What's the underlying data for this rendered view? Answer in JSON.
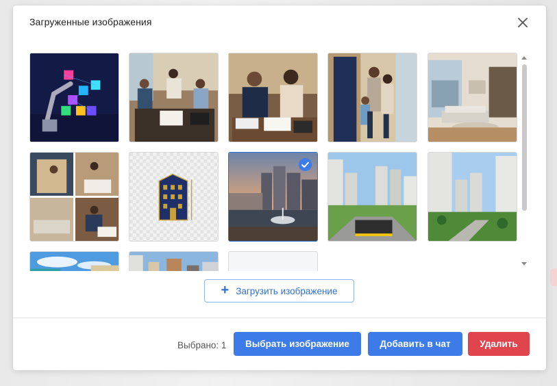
{
  "modal": {
    "title": "Загруженные изображения",
    "upload_label": "Загрузить изображение",
    "selected_label": "Выбрано: 1",
    "buttons": {
      "select": "Выбрать изображение",
      "add_to_chat": "Добавить в чат",
      "delete": "Удалить"
    }
  },
  "images": [
    {
      "name": "image-tile-tech-cubes",
      "selected": false
    },
    {
      "name": "image-tile-office-meeting",
      "selected": false
    },
    {
      "name": "image-tile-couple-signing",
      "selected": false
    },
    {
      "name": "image-tile-family-door",
      "selected": false
    },
    {
      "name": "image-tile-living-room",
      "selected": false
    },
    {
      "name": "image-tile-collage",
      "selected": false
    },
    {
      "name": "image-tile-building-logo",
      "selected": false
    },
    {
      "name": "image-tile-waterfront",
      "selected": true
    },
    {
      "name": "image-tile-residential-complex",
      "selected": false
    },
    {
      "name": "image-tile-park-towers",
      "selected": false
    },
    {
      "name": "image-tile-sky-buildings",
      "selected": false
    },
    {
      "name": "image-tile-city-towers",
      "selected": false
    },
    {
      "name": "image-tile-placeholder",
      "selected": false
    }
  ],
  "colors": {
    "primary": "#3d7ce8",
    "danger": "#e0444d",
    "selected_border": "#2f6fd6"
  },
  "icons": {
    "close": "close-icon",
    "plus": "plus-icon",
    "check": "check-icon",
    "scroll_up": "chevron-up-icon",
    "scroll_down": "chevron-down-icon"
  }
}
